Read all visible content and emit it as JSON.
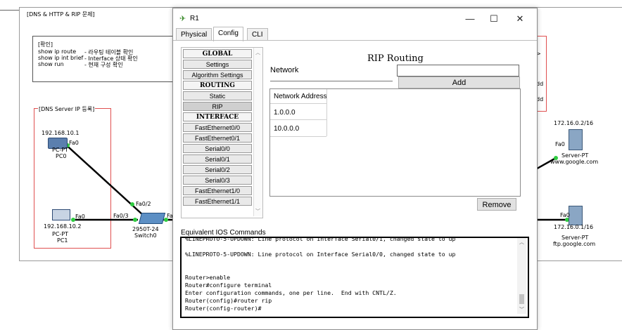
{
  "workspace": {
    "heading": "[DNS & HTTP & RIP 문제]",
    "check_note": {
      "title": "[확인]",
      "lines": [
        {
          "cmd": "show ip route",
          "desc": "- 라우팅 테이블 확인"
        },
        {
          "cmd": "show ip int brief",
          "desc": "- Interface 상태 확인"
        },
        {
          "cmd": "show run",
          "desc": "- 현재 구성 확인"
        }
      ]
    },
    "dns_server_label": "[DNS Server IP 등록]",
    "devices": {
      "pc0": {
        "ip": "192.168.10.1",
        "type": "PC-PT",
        "name": "PC0",
        "port": "Fa0"
      },
      "pc1": {
        "ip": "192.168.10.2",
        "type": "PC-PT",
        "name": "PC1",
        "port": "Fa0"
      },
      "switch0": {
        "type": "2950T-24",
        "name": "Switch0",
        "port_a": "Fa0/2",
        "port_b": "Fa0/3",
        "port_c": "Fa"
      },
      "server_google": {
        "ip": "172.16.0.2/16",
        "type": "Server-PT",
        "name": "www.google.com",
        "port": "Fa0"
      },
      "server_ftp": {
        "ip": "172.16.0.1/16",
        "type": "Server-PT",
        "name": "ftp.google.com",
        "port": "Fa0"
      }
    },
    "partial_right_labels": [
      ">",
      "dd",
      "dd"
    ]
  },
  "dialog": {
    "title": "R1",
    "controls": {
      "minimize": "—",
      "maximize": "☐",
      "close": "✕"
    },
    "tabs": [
      "Physical",
      "Config",
      "CLI"
    ],
    "active_tab": "Config",
    "nav": [
      {
        "label": "GLOBAL",
        "kind": "head"
      },
      {
        "label": "Settings",
        "kind": "item"
      },
      {
        "label": "Algorithm Settings",
        "kind": "item"
      },
      {
        "label": "ROUTING",
        "kind": "head"
      },
      {
        "label": "Static",
        "kind": "item"
      },
      {
        "label": "RIP",
        "kind": "selected"
      },
      {
        "label": "INTERFACE",
        "kind": "head"
      },
      {
        "label": "FastEthernet0/0",
        "kind": "item"
      },
      {
        "label": "FastEthernet0/1",
        "kind": "item"
      },
      {
        "label": "Serial0/0",
        "kind": "item"
      },
      {
        "label": "Serial0/1",
        "kind": "item"
      },
      {
        "label": "Serial0/2",
        "kind": "item"
      },
      {
        "label": "Serial0/3",
        "kind": "item"
      },
      {
        "label": "FastEthernet1/0",
        "kind": "item"
      },
      {
        "label": "FastEthernet1/1",
        "kind": "item"
      }
    ],
    "rip": {
      "heading": "RIP Routing",
      "network_label": "Network",
      "network_value": "",
      "add_button": "Add",
      "table_header": "Network Address",
      "networks": [
        "1.0.0.0",
        "10.0.0.0"
      ],
      "remove_button": "Remove"
    },
    "ios": {
      "label": "Equivalent IOS Commands",
      "lines": [
        "%LINEPROTO-5-UPDOWN: Line protocol on Interface Serial0/1, changed state to up",
        "",
        "%LINEPROTO-5-UPDOWN: Line protocol on Interface Serial0/0, changed state to up",
        "",
        "",
        "Router>enable",
        "Router#configure terminal",
        "Enter configuration commands, one per line.  End with CNTL/Z.",
        "Router(config)#router rip",
        "Router(config-router)#"
      ]
    }
  }
}
